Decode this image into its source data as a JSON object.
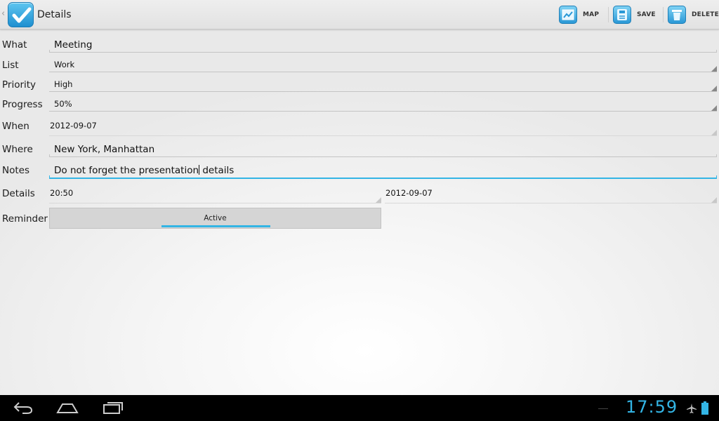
{
  "actionbar": {
    "title": "Details",
    "actions": {
      "map": "MAP",
      "save": "SAVE",
      "delete": "DELETE"
    }
  },
  "form": {
    "what": {
      "label": "What",
      "value": "Meeting"
    },
    "list": {
      "label": "List",
      "value": "Work"
    },
    "priority": {
      "label": "Priority",
      "value": "High"
    },
    "progress": {
      "label": "Progress",
      "value": "50%"
    },
    "when": {
      "label": "When",
      "value": "2012-09-07"
    },
    "where": {
      "label": "Where",
      "value": "New York, Manhattan"
    },
    "notes": {
      "label": "Notes",
      "value_before_cursor": "Do not forget the presentation",
      "value_after_cursor": " details"
    },
    "details": {
      "label": "Details",
      "time": "20:50",
      "date": "2012-09-07"
    },
    "reminder": {
      "label": "Reminder",
      "button": "Active"
    }
  },
  "systembar": {
    "clock": "17:59"
  },
  "colors": {
    "accent": "#33b5e5",
    "icon_blue": "#2a98d6"
  }
}
